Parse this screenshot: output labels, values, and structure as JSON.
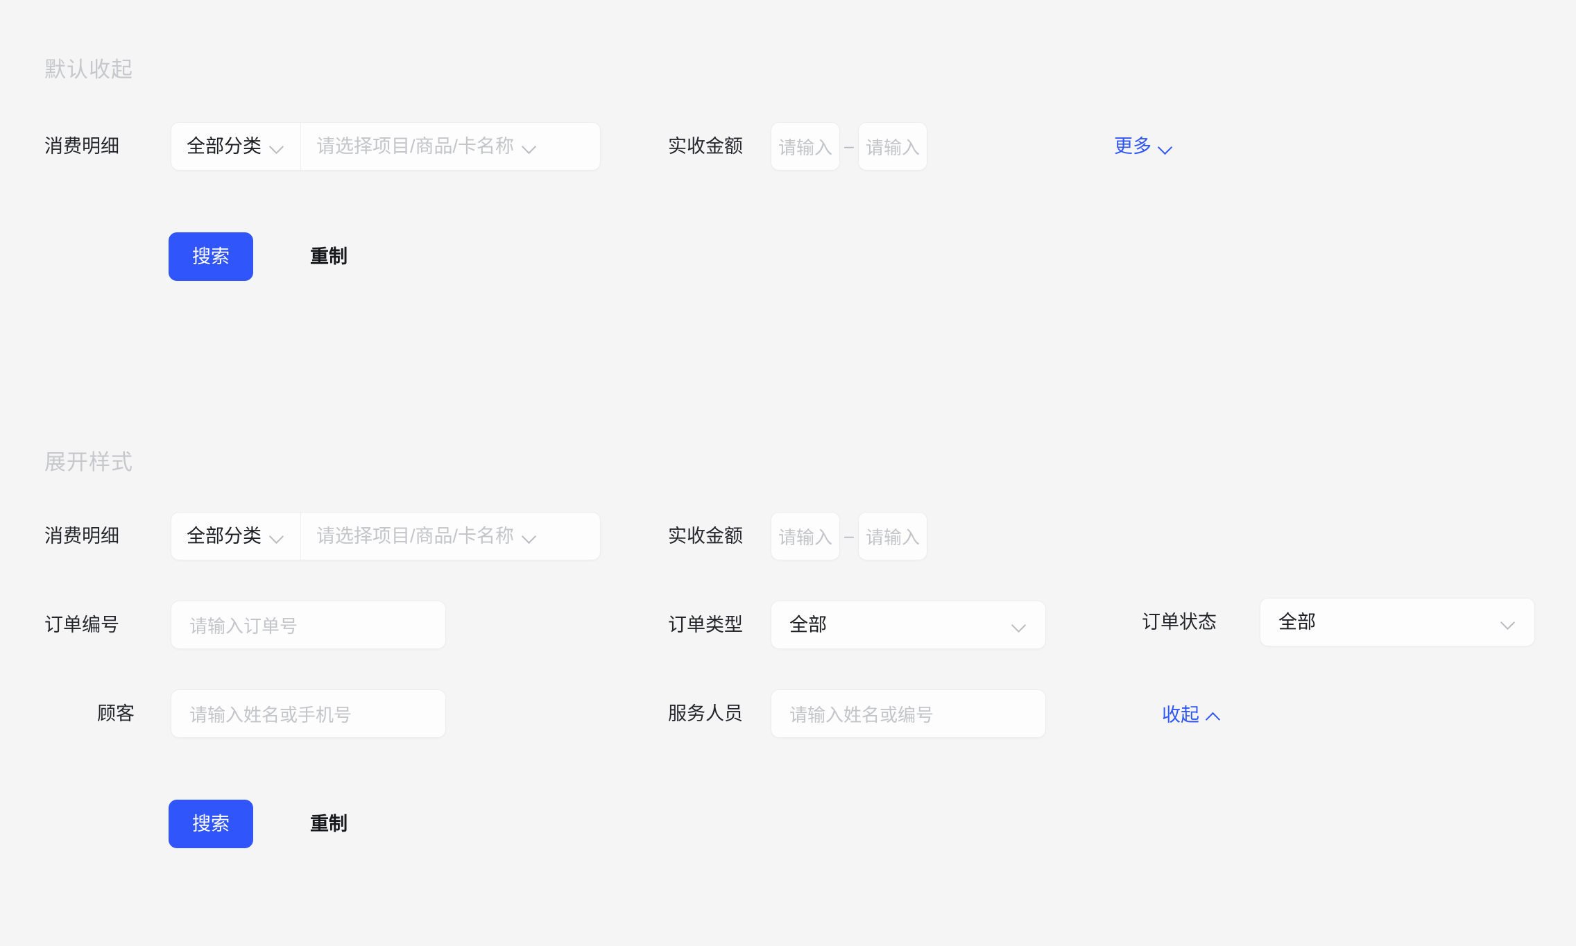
{
  "theme": {
    "background": "#f5f5f6",
    "accent": "#2f55fb",
    "control_bg": "#fdfdfd",
    "border": "#ededee",
    "label_color": "#24262b",
    "placeholder_color": "#c3c5c8",
    "section_title_color": "#c6c8cb"
  },
  "sections": {
    "collapsed": {
      "title": "默认收起",
      "row1": {
        "label": "消费明细",
        "category_select": "全部分类",
        "item_select_placeholder": "请选择项目/商品/卡名称",
        "amount_label": "实收金额",
        "amount_min_placeholder": "请输入",
        "amount_max_placeholder": "请输入",
        "range_separator": "–"
      },
      "toggle": {
        "label": "更多",
        "icon": "chevron-down-icon"
      },
      "actions": {
        "search": "搜索",
        "reset": "重制"
      }
    },
    "expanded": {
      "title": "展开样式",
      "row1": {
        "label": "消费明细",
        "category_select": "全部分类",
        "item_select_placeholder": "请选择项目/商品/卡名称",
        "amount_label": "实收金额",
        "amount_min_placeholder": "请输入",
        "amount_max_placeholder": "请输入",
        "range_separator": "–"
      },
      "row2": {
        "order_no_label": "订单编号",
        "order_no_placeholder": "请输入订单号",
        "order_type_label": "订单类型",
        "order_type_value": "全部",
        "order_status_label": "订单状态",
        "order_status_value": "全部"
      },
      "row3": {
        "customer_label": "顾客",
        "customer_placeholder": "请输入姓名或手机号",
        "staff_label": "服务人员",
        "staff_placeholder": "请输入姓名或编号"
      },
      "toggle": {
        "label": "收起",
        "icon": "chevron-up-icon"
      },
      "actions": {
        "search": "搜索",
        "reset": "重制"
      }
    }
  }
}
